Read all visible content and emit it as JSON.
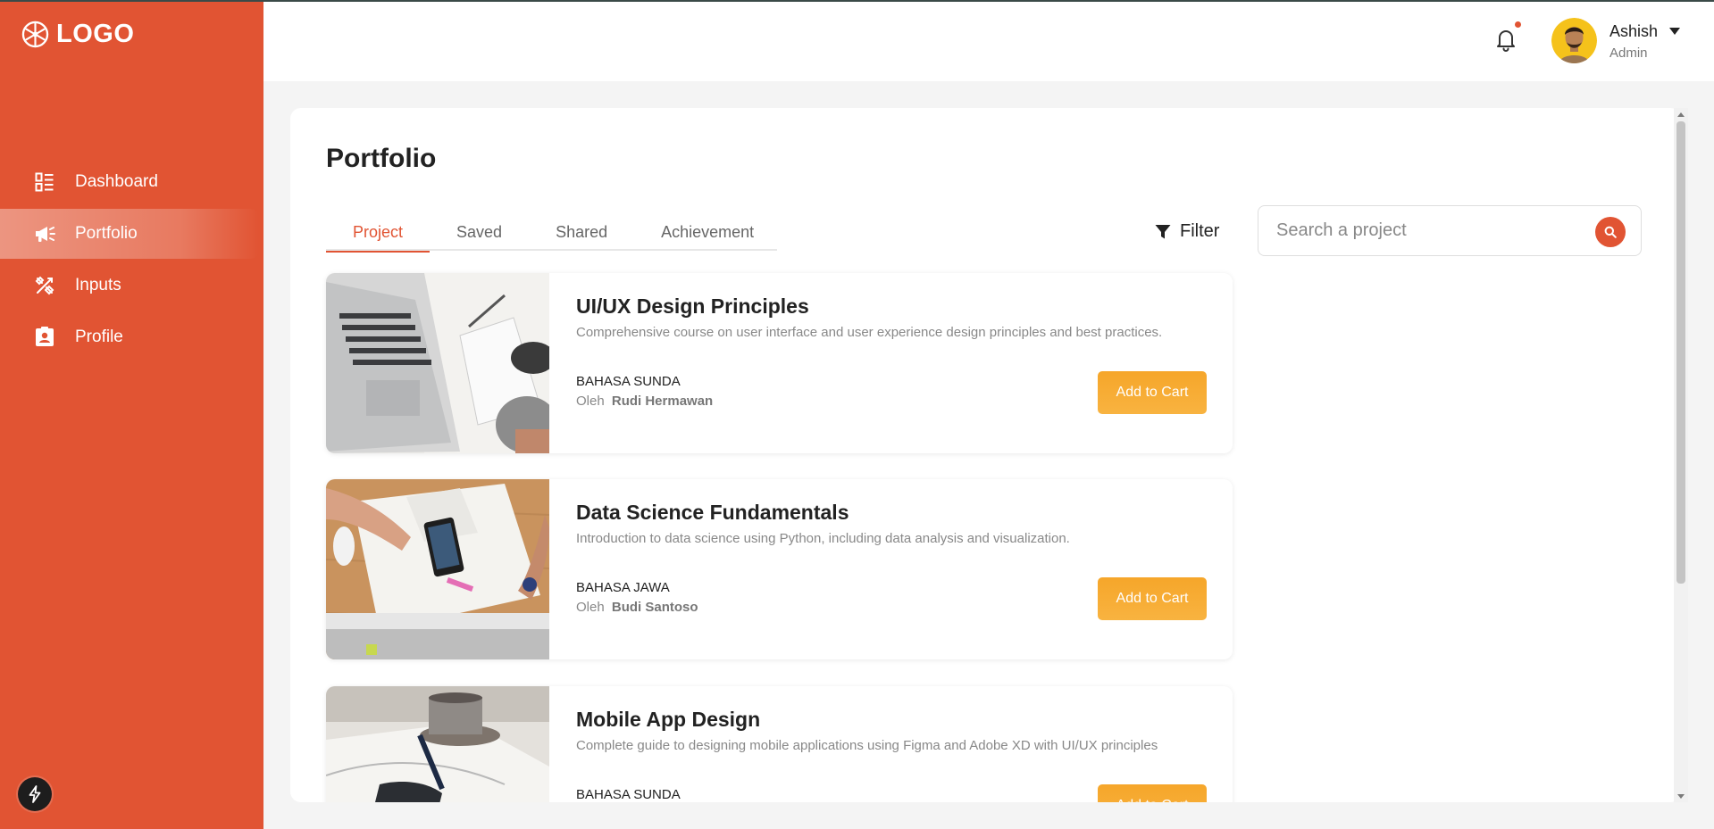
{
  "brand": {
    "logo_text": "LOGO",
    "accent_color": "#e15433",
    "button_color": "#f6a62a"
  },
  "sidebar": {
    "items": [
      {
        "label": "Dashboard",
        "icon": "dashboard-icon",
        "active": false
      },
      {
        "label": "Portfolio",
        "icon": "megaphone-icon",
        "active": true
      },
      {
        "label": "Inputs",
        "icon": "tools-icon",
        "active": false
      },
      {
        "label": "Profile",
        "icon": "id-card-icon",
        "active": false
      }
    ],
    "bottom_icon": "bolt-icon"
  },
  "header": {
    "notification_icon": "bell-icon",
    "has_unread": true,
    "user": {
      "name": "Ashish",
      "role": "Admin"
    }
  },
  "main": {
    "title": "Portfolio",
    "tabs": [
      {
        "label": "Project",
        "active": true
      },
      {
        "label": "Saved",
        "active": false
      },
      {
        "label": "Shared",
        "active": false
      },
      {
        "label": "Achievement",
        "active": false
      }
    ],
    "filter_label": "Filter",
    "search": {
      "placeholder": "Search a project",
      "value": ""
    },
    "courses": [
      {
        "title": "UI/UX Design Principles",
        "description": "Comprehensive course on user interface and user experience design principles and best practices.",
        "language": "BAHASA SUNDA",
        "by_prefix": "Oleh",
        "author": "Rudi Hermawan",
        "button_label": "Add to Cart"
      },
      {
        "title": "Data Science Fundamentals",
        "description": "Introduction to data science using Python, including data analysis and visualization.",
        "language": "BAHASA JAWA",
        "by_prefix": "Oleh",
        "author": "Budi Santoso",
        "button_label": "Add to Cart"
      },
      {
        "title": "Mobile App Design",
        "description": "Complete guide to designing mobile applications using Figma and Adobe XD with UI/UX principles",
        "language": "BAHASA SUNDA",
        "by_prefix": "",
        "author": "",
        "button_label": "Add to Cart"
      }
    ]
  }
}
